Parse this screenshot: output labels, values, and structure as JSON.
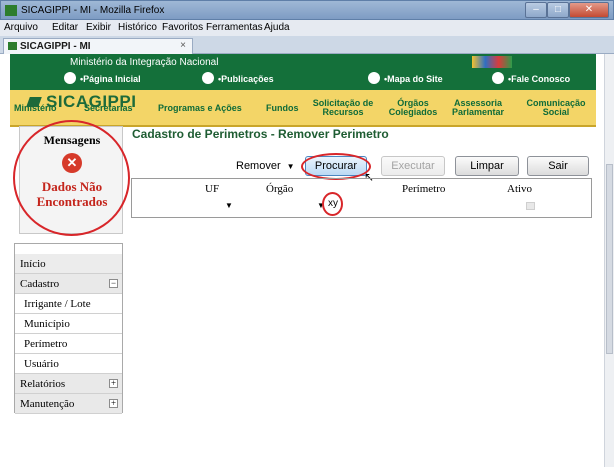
{
  "window": {
    "title": "SICAGIPPI - MI - Mozilla Firefox",
    "menu": [
      "Arquivo",
      "Editar",
      "Exibir",
      "Histórico",
      "Favoritos",
      "Ferramentas",
      "Ajuda"
    ],
    "tab_label": "SICAGIPPI - MI",
    "tab_close": "×"
  },
  "gov_bar": {
    "ministerio": "Ministério da Integração Nacional",
    "brasil": "BRASIL",
    "links": [
      "•Página Inicial",
      "•Publicações",
      "•Mapa do Site",
      "•Fale Conosco"
    ]
  },
  "nav": [
    "Ministério",
    "Secretarias",
    "Programas e Ações",
    "Fundos",
    "Solicitação de Recursos",
    "Órgãos Colegiados",
    "Assessoria Parlamentar",
    "Comunicação Social"
  ],
  "logo": "SICAGIPPI",
  "message_box": {
    "title": "Mensagens",
    "icon": "error-icon",
    "text": "Dados Não Encontrados"
  },
  "page": {
    "title": "Cadastro de Perimetros - Remover Perimetro",
    "mode_select": "Remover",
    "buttons": {
      "procurar": "Procurar",
      "executar": "Executar",
      "limpar": "Limpar",
      "sair": "Sair"
    },
    "grid_headers": {
      "uf": "UF",
      "orgao": "Órgão",
      "perimetro": "Perímetro",
      "ativo": "Ativo"
    },
    "orgao_value": "xy"
  },
  "side_menu": {
    "inicio": "Início",
    "cadastro": "Cadastro",
    "cadastro_items": [
      "Irrigante / Lote",
      "Município",
      "Perímetro",
      "Usuário"
    ],
    "relatorios": "Relatórios",
    "manutencao": "Manutenção",
    "collapse": "−",
    "expand": "+"
  },
  "colors": {
    "gov_green": "#14703a",
    "nav_yellow": "#f3d567",
    "title_green": "#1f5d33",
    "error_red": "#c4251c",
    "annotation_red": "#d8262a"
  }
}
